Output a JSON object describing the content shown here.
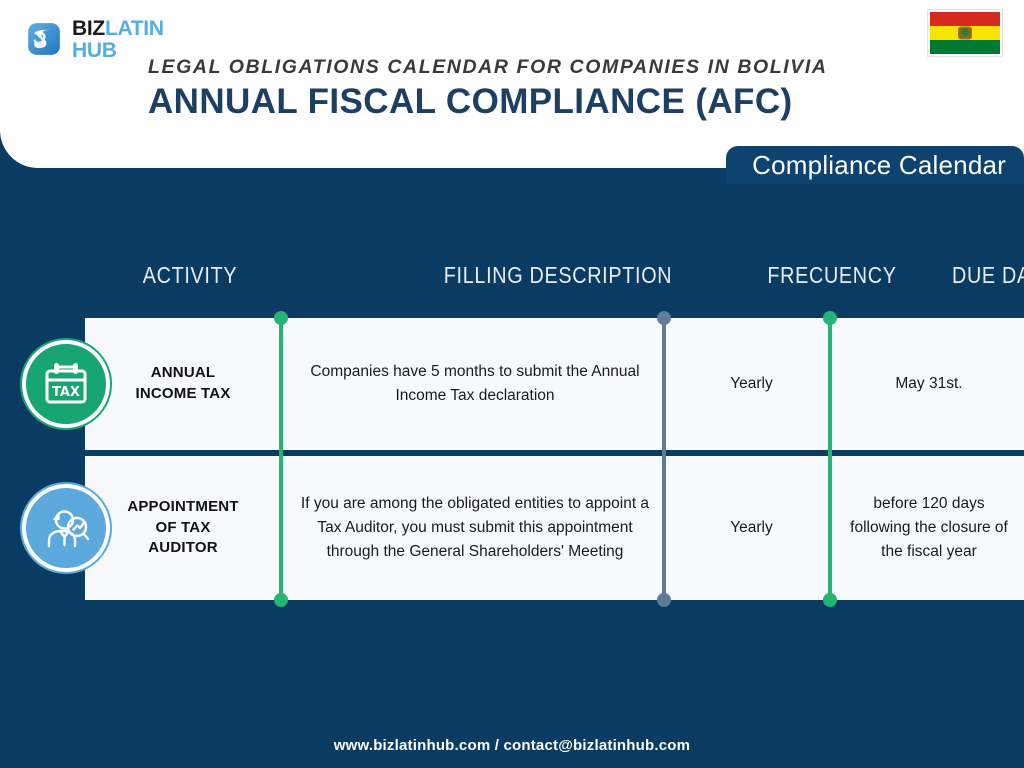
{
  "brand": {
    "logo_biz": "BIZ",
    "logo_latin": "LATIN",
    "logo_hub": "HUB",
    "logo_icon": "bizlatinhub-infinity-mark",
    "accent_navy": "#0a3c63",
    "accent_green": "#24b474",
    "accent_blue": "#5ba9dd",
    "accent_slate": "#5f7d99",
    "title_navy": "#1d3f62"
  },
  "flag": {
    "name": "bolivia-flag",
    "stripes": [
      "#d52b1e",
      "#f9e300",
      "#007a33"
    ],
    "emblem": "bolivia-coat-of-arms"
  },
  "header": {
    "eyebrow": "LEGAL OBLIGATIONS CALENDAR FOR COMPANIES IN BOLIVIA",
    "title": "ANNUAL FISCAL COMPLIANCE (AFC)"
  },
  "tab": {
    "label": "Compliance Calendar"
  },
  "table": {
    "columns": [
      {
        "key": "activity",
        "label": "ACTIVITY"
      },
      {
        "key": "description",
        "label": "FILLING DESCRIPTION"
      },
      {
        "key": "frequency",
        "label": "FRECUENCY"
      },
      {
        "key": "due_date",
        "label": "DUE DATE"
      }
    ],
    "rows": [
      {
        "icon": "tax-calendar-icon",
        "icon_label": "TAX",
        "icon_color": "#17a673",
        "activity": "ANNUAL\nINCOME TAX",
        "description": "Companies have 5 months to submit the Annual Income Tax declaration",
        "frequency": "Yearly",
        "due_date": "May 31st."
      },
      {
        "icon": "auditor-magnifier-icon",
        "icon_label": "",
        "icon_color": "#5ba9dd",
        "activity": "APPOINTMENT\nOF TAX\nAUDITOR",
        "description": "If you are among the obligated entities to appoint a Tax Auditor, you must submit this appointment through the General Shareholders' Meeting",
        "frequency": "Yearly",
        "due_date": "before 120 days following the closure of the fiscal year"
      }
    ]
  },
  "footer": {
    "text": "www.bizlatinhub.com / contact@bizlatinhub.com"
  }
}
